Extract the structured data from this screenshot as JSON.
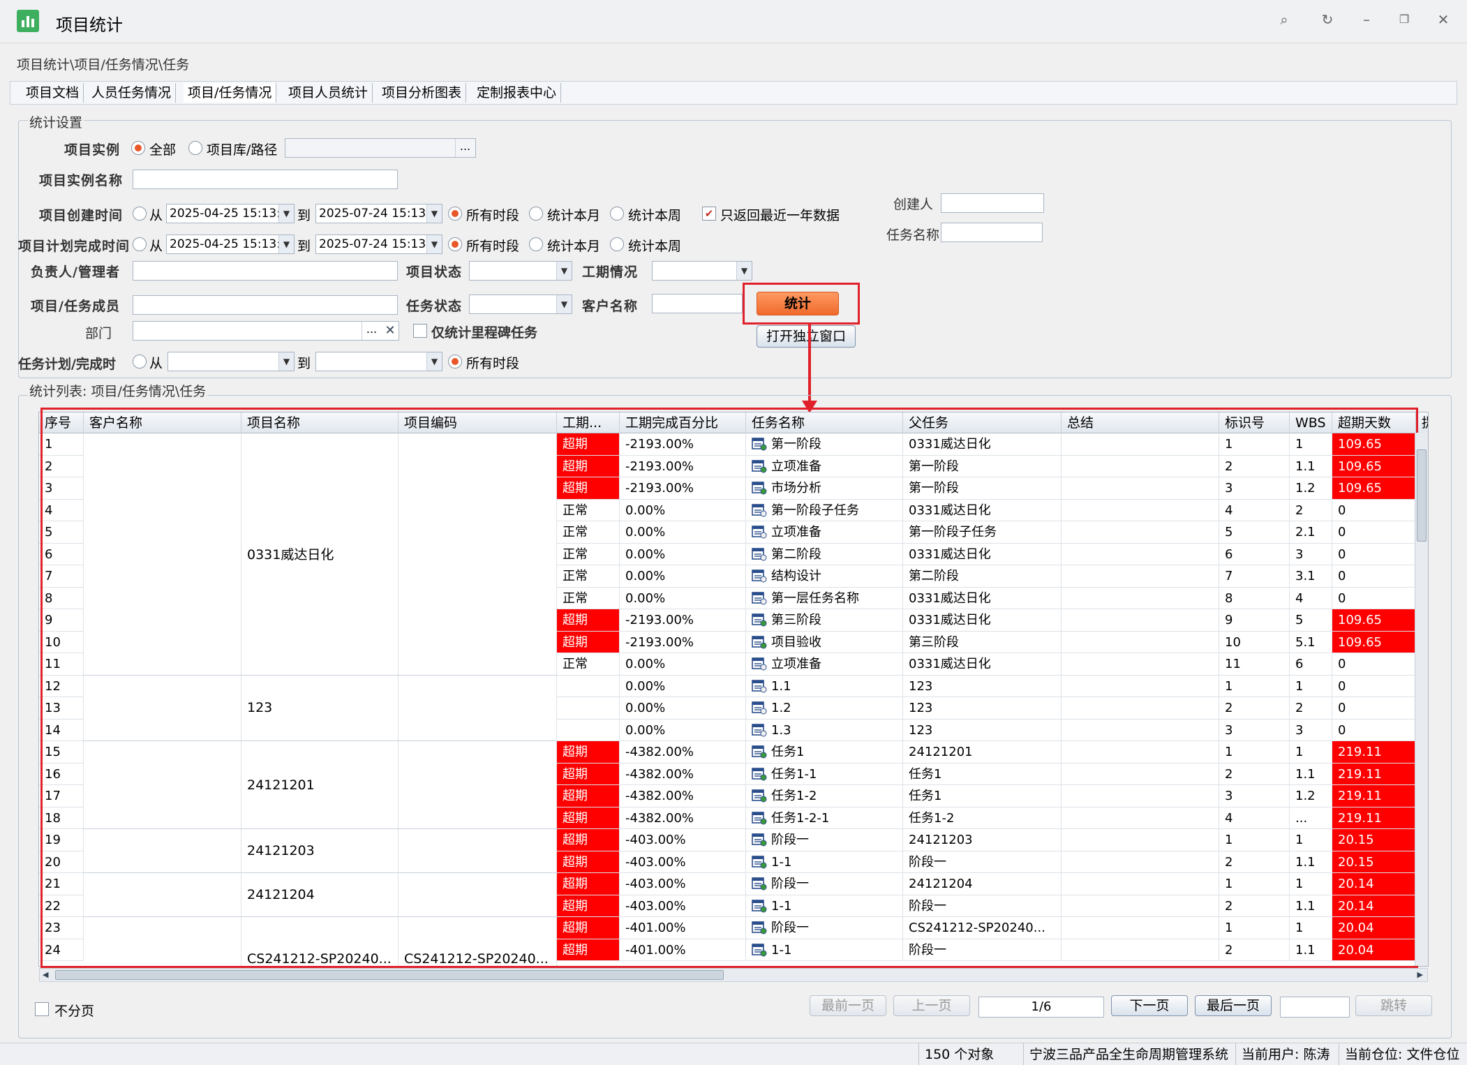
{
  "window": {
    "title": "项目统计",
    "icon": "bar-chart-icon"
  },
  "breadcrumb": "项目统计\\项目/任务情况\\任务",
  "tabs": [
    "项目文档",
    "人员任务情况",
    "项目/任务情况",
    "项目人员统计",
    "项目分析图表",
    "定制报表中心"
  ],
  "settings": {
    "legend": "统计设置",
    "project_instance": {
      "label": "项目实例",
      "opt_all": "全部",
      "opt_lib": "项目库/路径",
      "browse": "..."
    },
    "instance_name": {
      "label": "项目实例名称",
      "value": ""
    },
    "create_time": {
      "label": "项目创建时间",
      "from": "从",
      "from_value": "2025-04-25 15:13:",
      "to": "到",
      "to_value": "2025-07-24 15:13:",
      "all": "所有时段",
      "month": "统计本月",
      "week": "统计本周"
    },
    "recent_year": {
      "label": "只返回最近一年数据",
      "checked": true
    },
    "creator": {
      "label": "创建人",
      "value": ""
    },
    "task_name": {
      "label": "任务名称",
      "value": ""
    },
    "plan_finish": {
      "label": "项目计划完成时间",
      "from": "从",
      "from_value": "2025-04-25 15:13:",
      "to": "到",
      "to_value": "2025-07-24 15:13:",
      "all": "所有时段",
      "month": "统计本月",
      "week": "统计本周"
    },
    "owner": {
      "label": "负责人/管理者",
      "value": ""
    },
    "project_status": {
      "label": "项目状态",
      "value": ""
    },
    "duration_status": {
      "label": "工期情况",
      "value": ""
    },
    "member": {
      "label": "项目/任务成员",
      "value": ""
    },
    "task_status": {
      "label": "任务状态",
      "value": ""
    },
    "customer": {
      "label": "客户名称",
      "value": ""
    },
    "stat_button": "统计",
    "open_window_button": "打开独立窗口",
    "department": {
      "label": "部门",
      "browse": "...",
      "clear": "✕"
    },
    "milestone_only": {
      "label": "仅统计里程碑任务",
      "checked": false
    },
    "task_plan": {
      "label": "任务计划/完成时",
      "from": "从",
      "to": "到",
      "all": "所有时段"
    }
  },
  "list": {
    "legend": "统计列表: 项目/任务情况\\任务",
    "columns": [
      "序号",
      "客户名称",
      "项目名称",
      "项目编码",
      "工期...",
      "工期完成百分比",
      "任务名称",
      "父任务",
      "总结",
      "标识号",
      "WBS",
      "超期天数",
      "提"
    ],
    "rows": [
      {
        "no": "1",
        "status": "超期",
        "pct": "-2193.00%",
        "task": "第一阶段",
        "parent": "0331威达日化",
        "id": "1",
        "wbs": "1",
        "over": "109.65"
      },
      {
        "no": "2",
        "status": "超期",
        "pct": "-2193.00%",
        "task": "立项准备",
        "parent": "第一阶段",
        "id": "2",
        "wbs": "1.1",
        "over": "109.65"
      },
      {
        "no": "3",
        "status": "超期",
        "pct": "-2193.00%",
        "task": "市场分析",
        "parent": "第一阶段",
        "id": "3",
        "wbs": "1.2",
        "over": "109.65"
      },
      {
        "no": "4",
        "status": "正常",
        "pct": "0.00%",
        "task": "第一阶段子任务",
        "parent": "0331威达日化",
        "id": "4",
        "wbs": "2",
        "over": "0"
      },
      {
        "no": "5",
        "status": "正常",
        "pct": "0.00%",
        "task": "立项准备",
        "parent": "第一阶段子任务",
        "id": "5",
        "wbs": "2.1",
        "over": "0"
      },
      {
        "no": "6",
        "status": "正常",
        "pct": "0.00%",
        "task": "第二阶段",
        "parent": "0331威达日化",
        "id": "6",
        "wbs": "3",
        "over": "0"
      },
      {
        "no": "7",
        "status": "正常",
        "pct": "0.00%",
        "task": "结构设计",
        "parent": "第二阶段",
        "id": "7",
        "wbs": "3.1",
        "over": "0"
      },
      {
        "no": "8",
        "status": "正常",
        "pct": "0.00%",
        "task": "第一层任务名称",
        "parent": "0331威达日化",
        "id": "8",
        "wbs": "4",
        "over": "0"
      },
      {
        "no": "9",
        "status": "超期",
        "pct": "-2193.00%",
        "task": "第三阶段",
        "parent": "0331威达日化",
        "id": "9",
        "wbs": "5",
        "over": "109.65"
      },
      {
        "no": "10",
        "status": "超期",
        "pct": "-2193.00%",
        "task": "项目验收",
        "parent": "第三阶段",
        "id": "10",
        "wbs": "5.1",
        "over": "109.65"
      },
      {
        "no": "11",
        "status": "正常",
        "pct": "0.00%",
        "task": "立项准备",
        "parent": "0331威达日化",
        "id": "11",
        "wbs": "6",
        "over": "0"
      },
      {
        "no": "12",
        "status": "",
        "pct": "0.00%",
        "task": "1.1",
        "parent": "123",
        "id": "1",
        "wbs": "1",
        "over": "0"
      },
      {
        "no": "13",
        "status": "",
        "pct": "0.00%",
        "task": "1.2",
        "parent": "123",
        "id": "2",
        "wbs": "2",
        "over": "0"
      },
      {
        "no": "14",
        "status": "",
        "pct": "0.00%",
        "task": "1.3",
        "parent": "123",
        "id": "3",
        "wbs": "3",
        "over": "0"
      },
      {
        "no": "15",
        "status": "超期",
        "pct": "-4382.00%",
        "task": "任务1",
        "parent": "24121201",
        "id": "1",
        "wbs": "1",
        "over": "219.11"
      },
      {
        "no": "16",
        "status": "超期",
        "pct": "-4382.00%",
        "task": "任务1-1",
        "parent": "任务1",
        "id": "2",
        "wbs": "1.1",
        "over": "219.11"
      },
      {
        "no": "17",
        "status": "超期",
        "pct": "-4382.00%",
        "task": "任务1-2",
        "parent": "任务1",
        "id": "3",
        "wbs": "1.2",
        "over": "219.11"
      },
      {
        "no": "18",
        "status": "超期",
        "pct": "-4382.00%",
        "task": "任务1-2-1",
        "parent": "任务1-2",
        "id": "4",
        "wbs": "...",
        "over": "219.11"
      },
      {
        "no": "19",
        "status": "超期",
        "pct": "-403.00%",
        "task": "阶段一",
        "parent": "24121203",
        "id": "1",
        "wbs": "1",
        "over": "20.15"
      },
      {
        "no": "20",
        "status": "超期",
        "pct": "-403.00%",
        "task": "1-1",
        "parent": "阶段一",
        "id": "2",
        "wbs": "1.1",
        "over": "20.15"
      },
      {
        "no": "21",
        "status": "超期",
        "pct": "-403.00%",
        "task": "阶段一",
        "parent": "24121204",
        "id": "1",
        "wbs": "1",
        "over": "20.14"
      },
      {
        "no": "22",
        "status": "超期",
        "pct": "-403.00%",
        "task": "1-1",
        "parent": "阶段一",
        "id": "2",
        "wbs": "1.1",
        "over": "20.14"
      },
      {
        "no": "23",
        "status": "超期",
        "pct": "-401.00%",
        "task": "阶段一",
        "parent": "CS241212-SP20240...",
        "id": "1",
        "wbs": "1",
        "over": "20.04"
      },
      {
        "no": "24",
        "status": "超期",
        "pct": "-401.00%",
        "task": "1-1",
        "parent": "阶段一",
        "id": "2",
        "wbs": "1.1",
        "over": "20.04"
      }
    ],
    "groups": [
      {
        "name": "0331威达日化",
        "code": ""
      },
      {
        "name": "123",
        "code": ""
      },
      {
        "name": "24121201",
        "code": ""
      },
      {
        "name": "24121203",
        "code": ""
      },
      {
        "name": "24121204",
        "code": ""
      },
      {
        "name": "CS241212-SP20240...",
        "code": "CS241212-SP20240..."
      }
    ]
  },
  "pager": {
    "no_paging": "不分页",
    "first": "最前一页",
    "prev": "上一页",
    "page": "1/6",
    "next": "下一页",
    "last": "最后一页",
    "jump": "跳转",
    "jump_value": ""
  },
  "status": {
    "count": "150  个对象",
    "system": "宁波三品产品全生命周期管理系统",
    "user": "当前用户: 陈涛",
    "location": "当前仓位: 文件仓位"
  },
  "colors": {
    "overdue": "#fe0000",
    "highlight": "#e0202a",
    "accent": "#ef6a2c"
  }
}
